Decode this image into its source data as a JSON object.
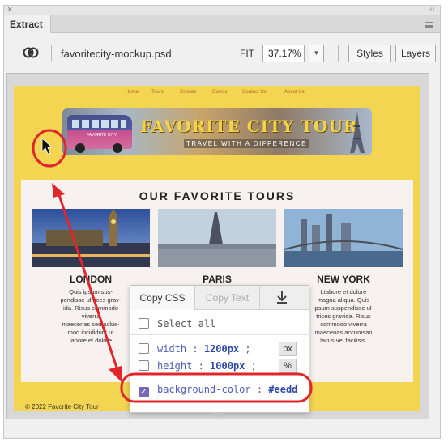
{
  "window": {
    "close_glyph": "×",
    "collapse_glyph": "‹‹",
    "tab_label": "Extract"
  },
  "toolbar": {
    "filename": "favoritecity-mockup.psd",
    "fit_label": "FIT",
    "zoom_value": "37.17%",
    "styles_label": "Styles",
    "layers_label": "Layers"
  },
  "mockup": {
    "nav": [
      "Home",
      "Tours",
      "Cruises",
      "Events",
      "Contact Us",
      "About Us"
    ],
    "banner_title": "FAVORITE CITY TOUR",
    "banner_subtitle": "TRAVEL WITH A DIFFERENCE",
    "bus_sign": "FAVORITE CITY",
    "section_title": "OUR FAVORITE TOURS",
    "cities": [
      {
        "name": "LONDON",
        "desc": [
          "Quis ipsum sus-",
          "pendisse ultrices grav-",
          "ida. Risus commodo",
          "viverra",
          "maecenas sed aclus-",
          "mod incididunt ut",
          "labore et dolore"
        ]
      },
      {
        "name": "PARIS",
        "desc": []
      },
      {
        "name": "NEW YORK",
        "desc": [
          "Ltabore et dolore",
          "magna aliqua. Quis",
          "ipsum suspendisse ul-",
          "trices gravida. Risus",
          "commodo viverra",
          "maecenas accumsan",
          "lacus vel facilisis."
        ]
      }
    ],
    "footer": "© 2022 Favorite City Tour",
    "colors": {
      "page_bg": "#f3d552",
      "section_bg": "#f7f1ef",
      "annotation": "#e0262a"
    }
  },
  "popup": {
    "copy_css": "Copy CSS",
    "copy_text": "Copy Text",
    "select_all": "Select all",
    "rows": [
      {
        "prop": "width",
        "value": "1200px",
        "unit": "px",
        "checked": false
      },
      {
        "prop": "height",
        "value": "1000px",
        "unit": "%",
        "checked": false
      },
      {
        "prop": "background-color",
        "value": "#eedd",
        "checked": true
      }
    ]
  }
}
